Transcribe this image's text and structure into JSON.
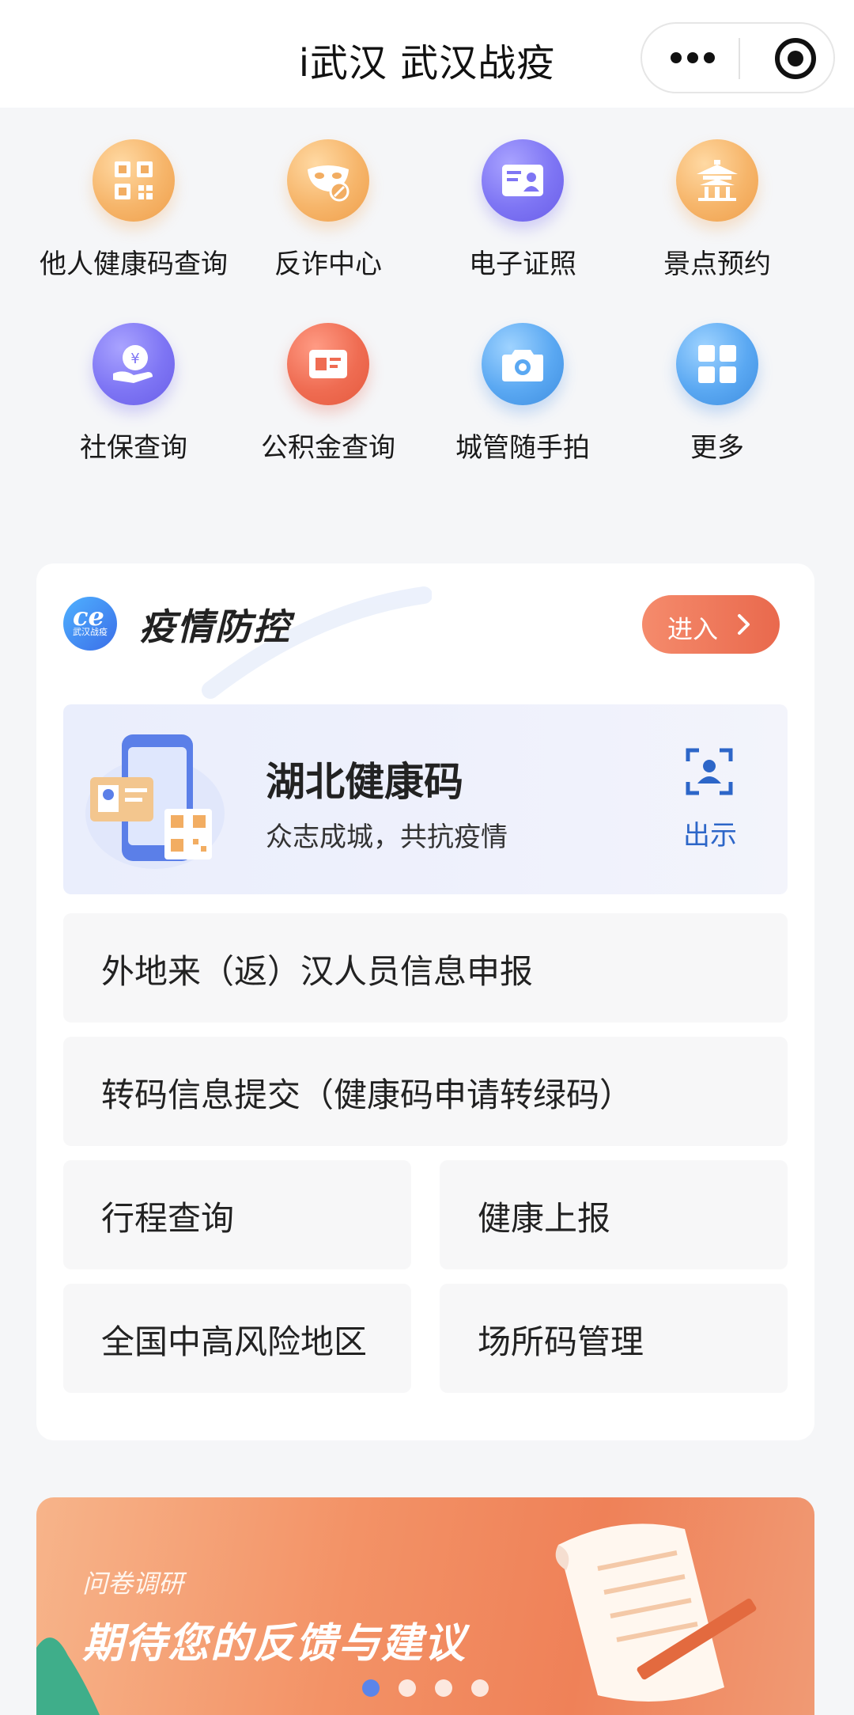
{
  "header": {
    "title": "i武汉 武汉战疫"
  },
  "services": [
    {
      "label": "他人健康码查询",
      "icon": "qr-code-icon",
      "color": "#f2ad62"
    },
    {
      "label": "反诈中心",
      "icon": "mask-icon",
      "color": "#f2ad62"
    },
    {
      "label": "电子证照",
      "icon": "id-card-icon",
      "color": "#7e75f4"
    },
    {
      "label": "景点预约",
      "icon": "pavilion-icon",
      "color": "#f2ad62"
    },
    {
      "label": "社保查询",
      "icon": "social-security-icon",
      "color": "#7e75f4"
    },
    {
      "label": "公积金查询",
      "icon": "housing-fund-icon",
      "color": "#ef6c52"
    },
    {
      "label": "城管随手拍",
      "icon": "camera-icon",
      "color": "#5aa8f2"
    },
    {
      "label": "更多",
      "icon": "grid-more-icon",
      "color": "#5aa8f2"
    }
  ],
  "epidemic": {
    "logo_text": "武汉战疫",
    "title": "疫情防控",
    "enter_label": "进入",
    "health_code": {
      "title": "湖北健康码",
      "subtitle": "众志成城，共抗疫情",
      "show_label": "出示"
    },
    "items": [
      "外地来（返）汉人员信息申报",
      "转码信息提交（健康码申请转绿码）",
      "行程查询",
      "健康上报",
      "全国中高风险地区",
      "场所码管理"
    ]
  },
  "banner": {
    "eyebrow": "问卷调研",
    "title": "期待您的反馈与建议",
    "page_count": 4,
    "active_page": 1
  },
  "colors": {
    "accent_orange": "#e9694d",
    "link_blue": "#2d66c8",
    "page_bg": "#f5f6f8"
  }
}
